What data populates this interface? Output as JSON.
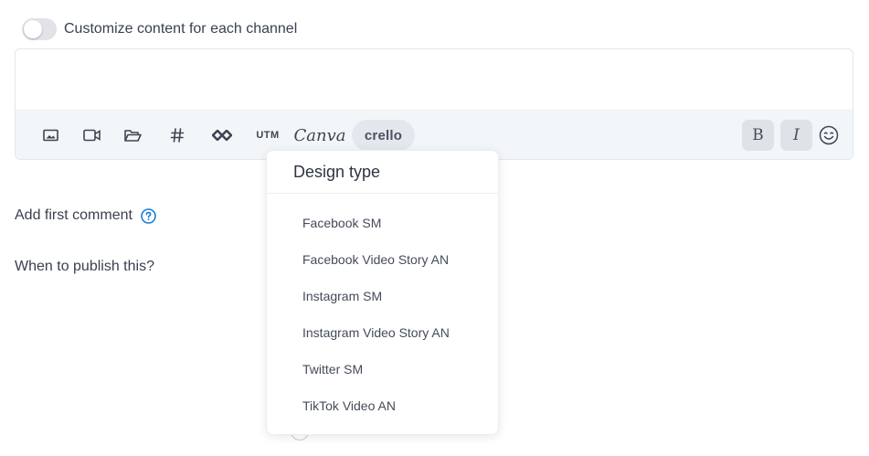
{
  "customize": {
    "label": "Customize content for each channel",
    "enabled": false
  },
  "toolbar": {
    "icons": [
      "image-icon",
      "video-icon",
      "folder-open-icon",
      "hashtag-icon",
      "link-shortener-icon"
    ],
    "utm_label": "UTM",
    "canva_label": "Canva",
    "crello_label": "crello",
    "bold_label": "B",
    "italic_label": "I",
    "emoji_icon": "emoji-icon"
  },
  "first_comment": {
    "label": "Add first comment",
    "help_icon": "question-circle-icon",
    "accent_color": "#1a7fd4"
  },
  "publish": {
    "label": "When to publish this?"
  },
  "design_dropdown": {
    "title": "Design type",
    "items": [
      "Facebook SM",
      "Facebook Video Story AN",
      "Instagram SM",
      "Instagram Video Story AN",
      "Twitter SM",
      "TikTok Video AN"
    ]
  }
}
